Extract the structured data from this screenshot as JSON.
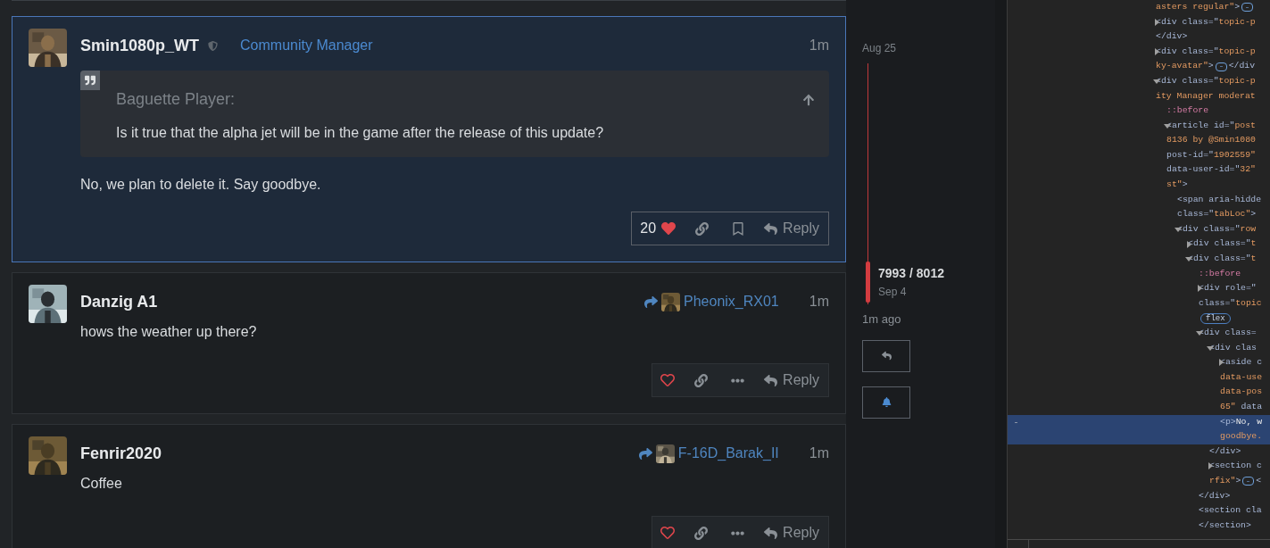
{
  "posts": [
    {
      "username": "Smin1080p_WT",
      "moderator": true,
      "user_title": "Community Manager",
      "time": "1m",
      "highlighted": true,
      "avatar": {
        "kind": "picture"
      },
      "quote": {
        "author": "Baguette Player:",
        "text": "Is it true that the alpha jet will be in the game after the release of this update?"
      },
      "body": "No, we plan to delete it. Say goodbye.",
      "actions": [
        {
          "kind": "like",
          "liked": true,
          "count": "20"
        },
        {
          "kind": "link"
        },
        {
          "kind": "bookmark"
        },
        {
          "kind": "reply",
          "label": "Reply"
        }
      ]
    },
    {
      "username": "Danzig A1",
      "moderator": false,
      "time": "1m",
      "highlighted": false,
      "avatar": {
        "kind": "picture"
      },
      "reply_to": {
        "username": "Pheonix_RX01"
      },
      "body": "hows the weather up there?",
      "actions": [
        {
          "kind": "like",
          "liked": false
        },
        {
          "kind": "link"
        },
        {
          "kind": "more"
        },
        {
          "kind": "reply",
          "label": "Reply"
        }
      ]
    },
    {
      "username": "Fenrir2020",
      "moderator": false,
      "time": "1m",
      "highlighted": false,
      "avatar": {
        "kind": "picture"
      },
      "reply_to": {
        "username": "F-16D_Barak_II"
      },
      "body": "Coffee",
      "actions": [
        {
          "kind": "like",
          "liked": false
        },
        {
          "kind": "link"
        },
        {
          "kind": "more"
        },
        {
          "kind": "reply",
          "label": "Reply"
        }
      ]
    }
  ],
  "timeline": {
    "start_date": "Aug 25",
    "position": "7993 / 8012",
    "position_date": "Sep 4",
    "level": 0.99,
    "last_activity": "1m ago",
    "buttons": [
      {
        "kind": "reply"
      },
      {
        "kind": "notifications"
      }
    ]
  },
  "devtools": {
    "nodes": [
      {
        "lines": [
          "asters regular\">"
        ],
        "collapsed_content": true
      },
      {
        "lines": [
          "<div class=\"topic-p",
          "</div>"
        ],
        "expanded": false
      },
      {
        "lines": [
          "<div class=\"topic-p",
          "ky-avatar\">"
        ],
        "expanded": false,
        "collapsed_content": true,
        "tail": "</div"
      },
      {
        "lines": [
          "<div class=\"topic-p",
          "ity Manager moderat"
        ],
        "expanded": true,
        "children": [
          {
            "lines": [
              "::before"
            ],
            "kind": "pseudo"
          },
          {
            "lines": [
              "<article id=\"post",
              "8136 by @Smin1080",
              "post-id=\"1902559\"",
              "data-user-id=\"32\"",
              "st\">"
            ],
            "expanded": true,
            "children": [
              {
                "lines": [
                  "<span aria-hidde",
                  "class=\"tabLoc\">"
                ]
              },
              {
                "lines": [
                  "<div class=\"row"
                ],
                "expanded": true,
                "children": [
                  {
                    "lines": [
                      "<div class=\"t"
                    ],
                    "expanded": false
                  },
                  {
                    "lines": [
                      "<div class=\"t"
                    ],
                    "expanded": true,
                    "children": [
                      {
                        "lines": [
                          "::before"
                        ],
                        "kind": "pseudo"
                      },
                      {
                        "lines": [
                          "<div role=\"",
                          "class=\"topic"
                        ],
                        "expanded": false,
                        "badge": "flex"
                      },
                      {
                        "lines": [
                          "<div class="
                        ],
                        "expanded": true,
                        "children": [
                          {
                            "lines": [
                              "<div clas"
                            ],
                            "expanded": true,
                            "children": [
                              {
                                "lines": [
                                  "<aside c",
                                  "data-use",
                                  "data-pos",
                                  "65\" data"
                                ],
                                "expanded": false
                              },
                              {
                                "lines": [
                                  "<p>No, w",
                                  "goodbye."
                                ],
                                "selected": true
                              }
                            ]
                          },
                          {
                            "lines": [
                              "</div>"
                            ]
                          },
                          {
                            "lines": [
                              "<section c",
                              "rfix\">"
                            ],
                            "expanded": false,
                            "collapsed_content": true,
                            "tail": "<"
                          }
                        ]
                      },
                      {
                        "lines": [
                          "</div>"
                        ]
                      },
                      {
                        "lines": [
                          "<section cla",
                          "</section>"
                        ]
                      }
                    ]
                  }
                ]
              }
            ]
          }
        ]
      }
    ]
  }
}
